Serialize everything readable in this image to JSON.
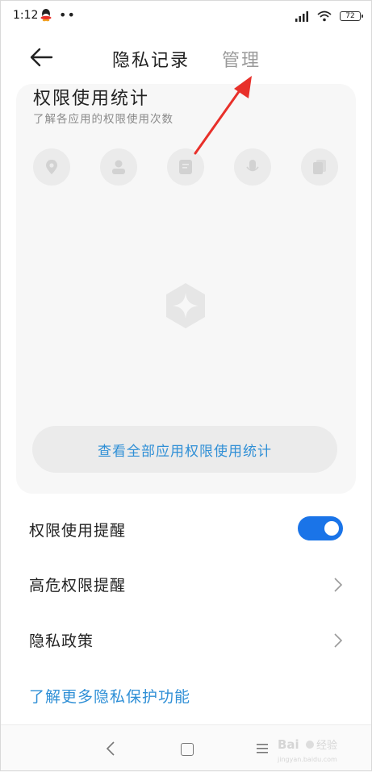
{
  "status_bar": {
    "time": "1:12",
    "dots": "••",
    "battery": "72"
  },
  "header": {
    "back_label": "←",
    "title": "隐私记录",
    "manage_label": "管理"
  },
  "stats_card": {
    "title": "权限使用统计",
    "subtitle": "了解各应用的权限使用次数",
    "permission_icons": [
      "location-icon",
      "contacts-icon",
      "sms-icon",
      "microphone-icon",
      "files-icon"
    ],
    "view_all_label": "查看全部应用权限使用统计"
  },
  "settings": {
    "usage_reminder_label": "权限使用提醒",
    "usage_reminder_on": true,
    "high_risk_label": "高危权限提醒",
    "privacy_policy_label": "隐私政策"
  },
  "more_link": "了解更多隐私保护功能",
  "watermark_text": "Baidu 经验",
  "colors": {
    "accent": "#1a74e8",
    "link": "#2f8fd6",
    "annotation": "#e8302a"
  }
}
